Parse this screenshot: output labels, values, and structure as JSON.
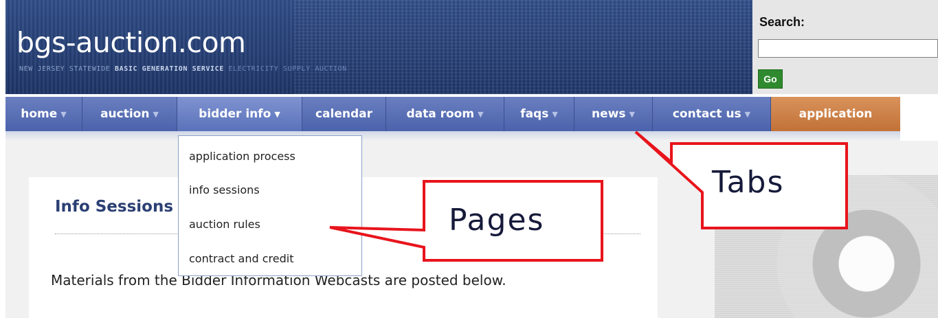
{
  "header": {
    "site_title": "bgs-auction.com",
    "tagline_part1": "NEW JERSEY STATEWIDE ",
    "tagline_part2": "BASIC GENERATION SERVICE",
    "tagline_part3": " ELECTRICITY SUPPLY AUCTION"
  },
  "search": {
    "label": "Search:",
    "value": "",
    "go_label": "Go"
  },
  "nav": {
    "tabs": [
      {
        "label": "home",
        "dropdown": true
      },
      {
        "label": "auction",
        "dropdown": true
      },
      {
        "label": "bidder info",
        "dropdown": true,
        "active": true
      },
      {
        "label": "calendar",
        "dropdown": false
      },
      {
        "label": "data room",
        "dropdown": true
      },
      {
        "label": "faqs",
        "dropdown": true
      },
      {
        "label": "news",
        "dropdown": true
      },
      {
        "label": "contact us",
        "dropdown": true
      },
      {
        "label": "application",
        "dropdown": false
      }
    ],
    "caret": "▼"
  },
  "dropdown": {
    "items": [
      "application process",
      "info sessions",
      "auction rules",
      "contract and credit"
    ]
  },
  "content": {
    "heading": "Info Sessions",
    "body": "Materials from the Bidder Information Webcasts are posted below."
  },
  "annotations": {
    "tabs_label": "Tabs",
    "pages_label": "Pages",
    "callout_color": "#e8141c"
  }
}
